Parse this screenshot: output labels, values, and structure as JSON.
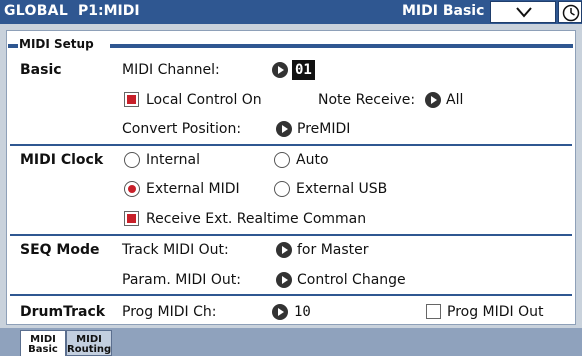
{
  "header": {
    "mode": "GLOBAL",
    "page_code": "P1:MIDI",
    "page_name": "MIDI Basic"
  },
  "section": {
    "title": "MIDI Setup"
  },
  "basic": {
    "label": "Basic",
    "midi_channel_label": "MIDI Channel:",
    "midi_channel_value": "01",
    "local_control_label": "Local Control On",
    "local_control_checked": true,
    "note_receive_label": "Note Receive:",
    "note_receive_value": "All",
    "convert_position_label": "Convert Position:",
    "convert_position_value": "PreMIDI"
  },
  "midi_clock": {
    "label": "MIDI Clock",
    "options": [
      "Internal",
      "Auto",
      "External MIDI",
      "External USB"
    ],
    "selected": "External MIDI",
    "receive_realtime_label": "Receive Ext. Realtime Comman",
    "receive_realtime_checked": true
  },
  "seq_mode": {
    "label": "SEQ Mode",
    "track_midi_out_label": "Track MIDI Out:",
    "track_midi_out_value": "for Master",
    "param_midi_out_label": "Param. MIDI Out:",
    "param_midi_out_value": "Control Change"
  },
  "drumtrack": {
    "label": "DrumTrack",
    "prog_midi_ch_label": "Prog MIDI Ch:",
    "prog_midi_ch_value": "10",
    "prog_midi_out_label": "Prog MIDI Out",
    "prog_midi_out_checked": false
  },
  "tabs": [
    {
      "line1": "MIDI",
      "line2": "Basic",
      "active": true
    },
    {
      "line1": "MIDI",
      "line2": "Routing",
      "active": false
    }
  ],
  "icons": {
    "page_menu": "chevron-down-icon",
    "clock": "clock-icon",
    "value_arrow": "popup-arrow-icon"
  },
  "colors": {
    "title_bar": "#2f5791",
    "selected_indicator": "#c8202a",
    "tab_bar": "#8fa2bd"
  }
}
